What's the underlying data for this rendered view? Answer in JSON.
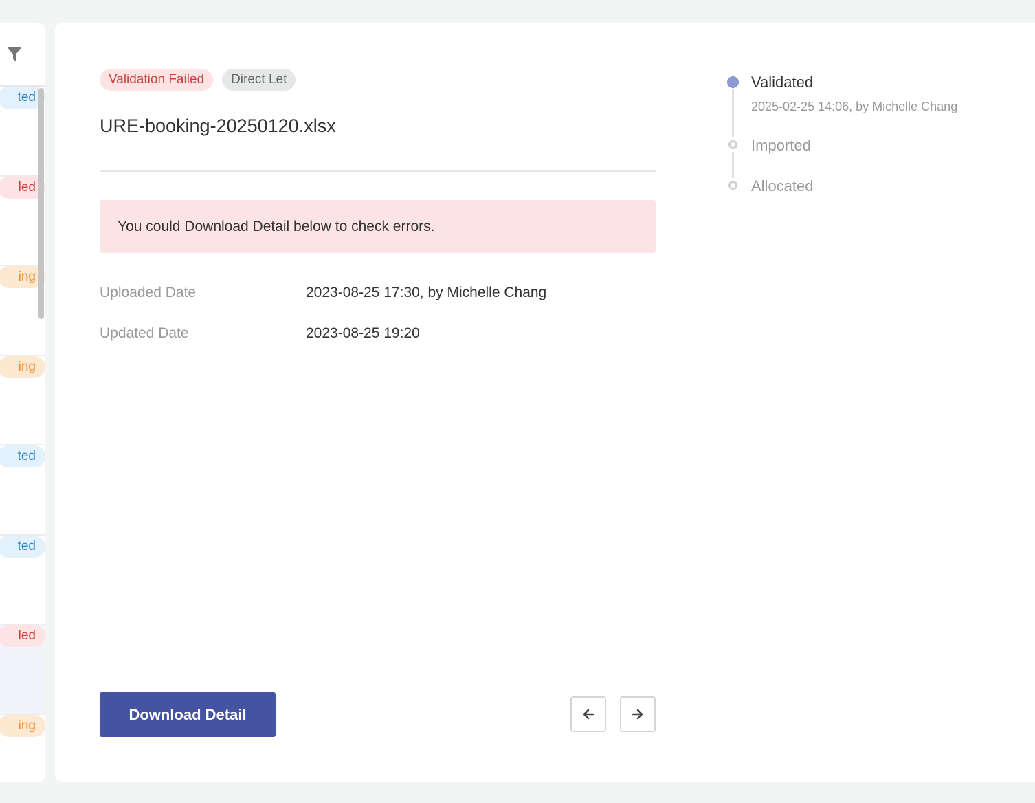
{
  "list_panel": {
    "filter_icon": "filter-icon",
    "items": [
      {
        "status_label": "Validated",
        "status_color": "blue"
      },
      {
        "status_label": "Validation Failed",
        "status_color": "red"
      },
      {
        "status_label": "Processing",
        "status_color": "orange"
      },
      {
        "status_label": "Processing",
        "status_color": "orange"
      },
      {
        "status_label": "Validated",
        "status_color": "blue"
      },
      {
        "status_label": "Validated",
        "status_color": "blue"
      },
      {
        "status_label": "Validation Failed",
        "status_color": "red",
        "selected": true
      },
      {
        "status_label": "Processing",
        "status_color": "orange"
      }
    ],
    "visible_suffixes": [
      "ted",
      "led",
      "ing",
      "ing",
      "ted",
      "ted",
      "led",
      "ing"
    ]
  },
  "detail": {
    "status_badge": "Validation Failed",
    "type_badge": "Direct Let",
    "file_name": "URE-booking-20250120.xlsx",
    "alert_message": "You could Download Detail below to check errors.",
    "fields": [
      {
        "label": "Uploaded Date",
        "value": "2023-08-25 17:30, by Michelle Chang"
      },
      {
        "label": "Updated Date",
        "value": "2023-08-25 19:20"
      }
    ],
    "download_label": "Download Detail",
    "prev_icon": "arrow-left-icon",
    "next_icon": "arrow-right-icon"
  },
  "timeline": {
    "steps": [
      {
        "label": "Validated",
        "sub": "2025-02-25 14:06, by Michelle Chang",
        "state": "done"
      },
      {
        "label": "Imported",
        "state": "pending"
      },
      {
        "label": "Allocated",
        "state": "pending"
      }
    ]
  },
  "colors": {
    "primary": "#4453a2",
    "status_failed_bg": "#fde3e3",
    "status_failed_text": "#c8433f",
    "validated_bg": "#e3f1fc",
    "validated_text": "#2b84c8",
    "processing_bg": "#fde8d2",
    "processing_text": "#e88b2c",
    "timeline_done": "#8c99d2"
  }
}
